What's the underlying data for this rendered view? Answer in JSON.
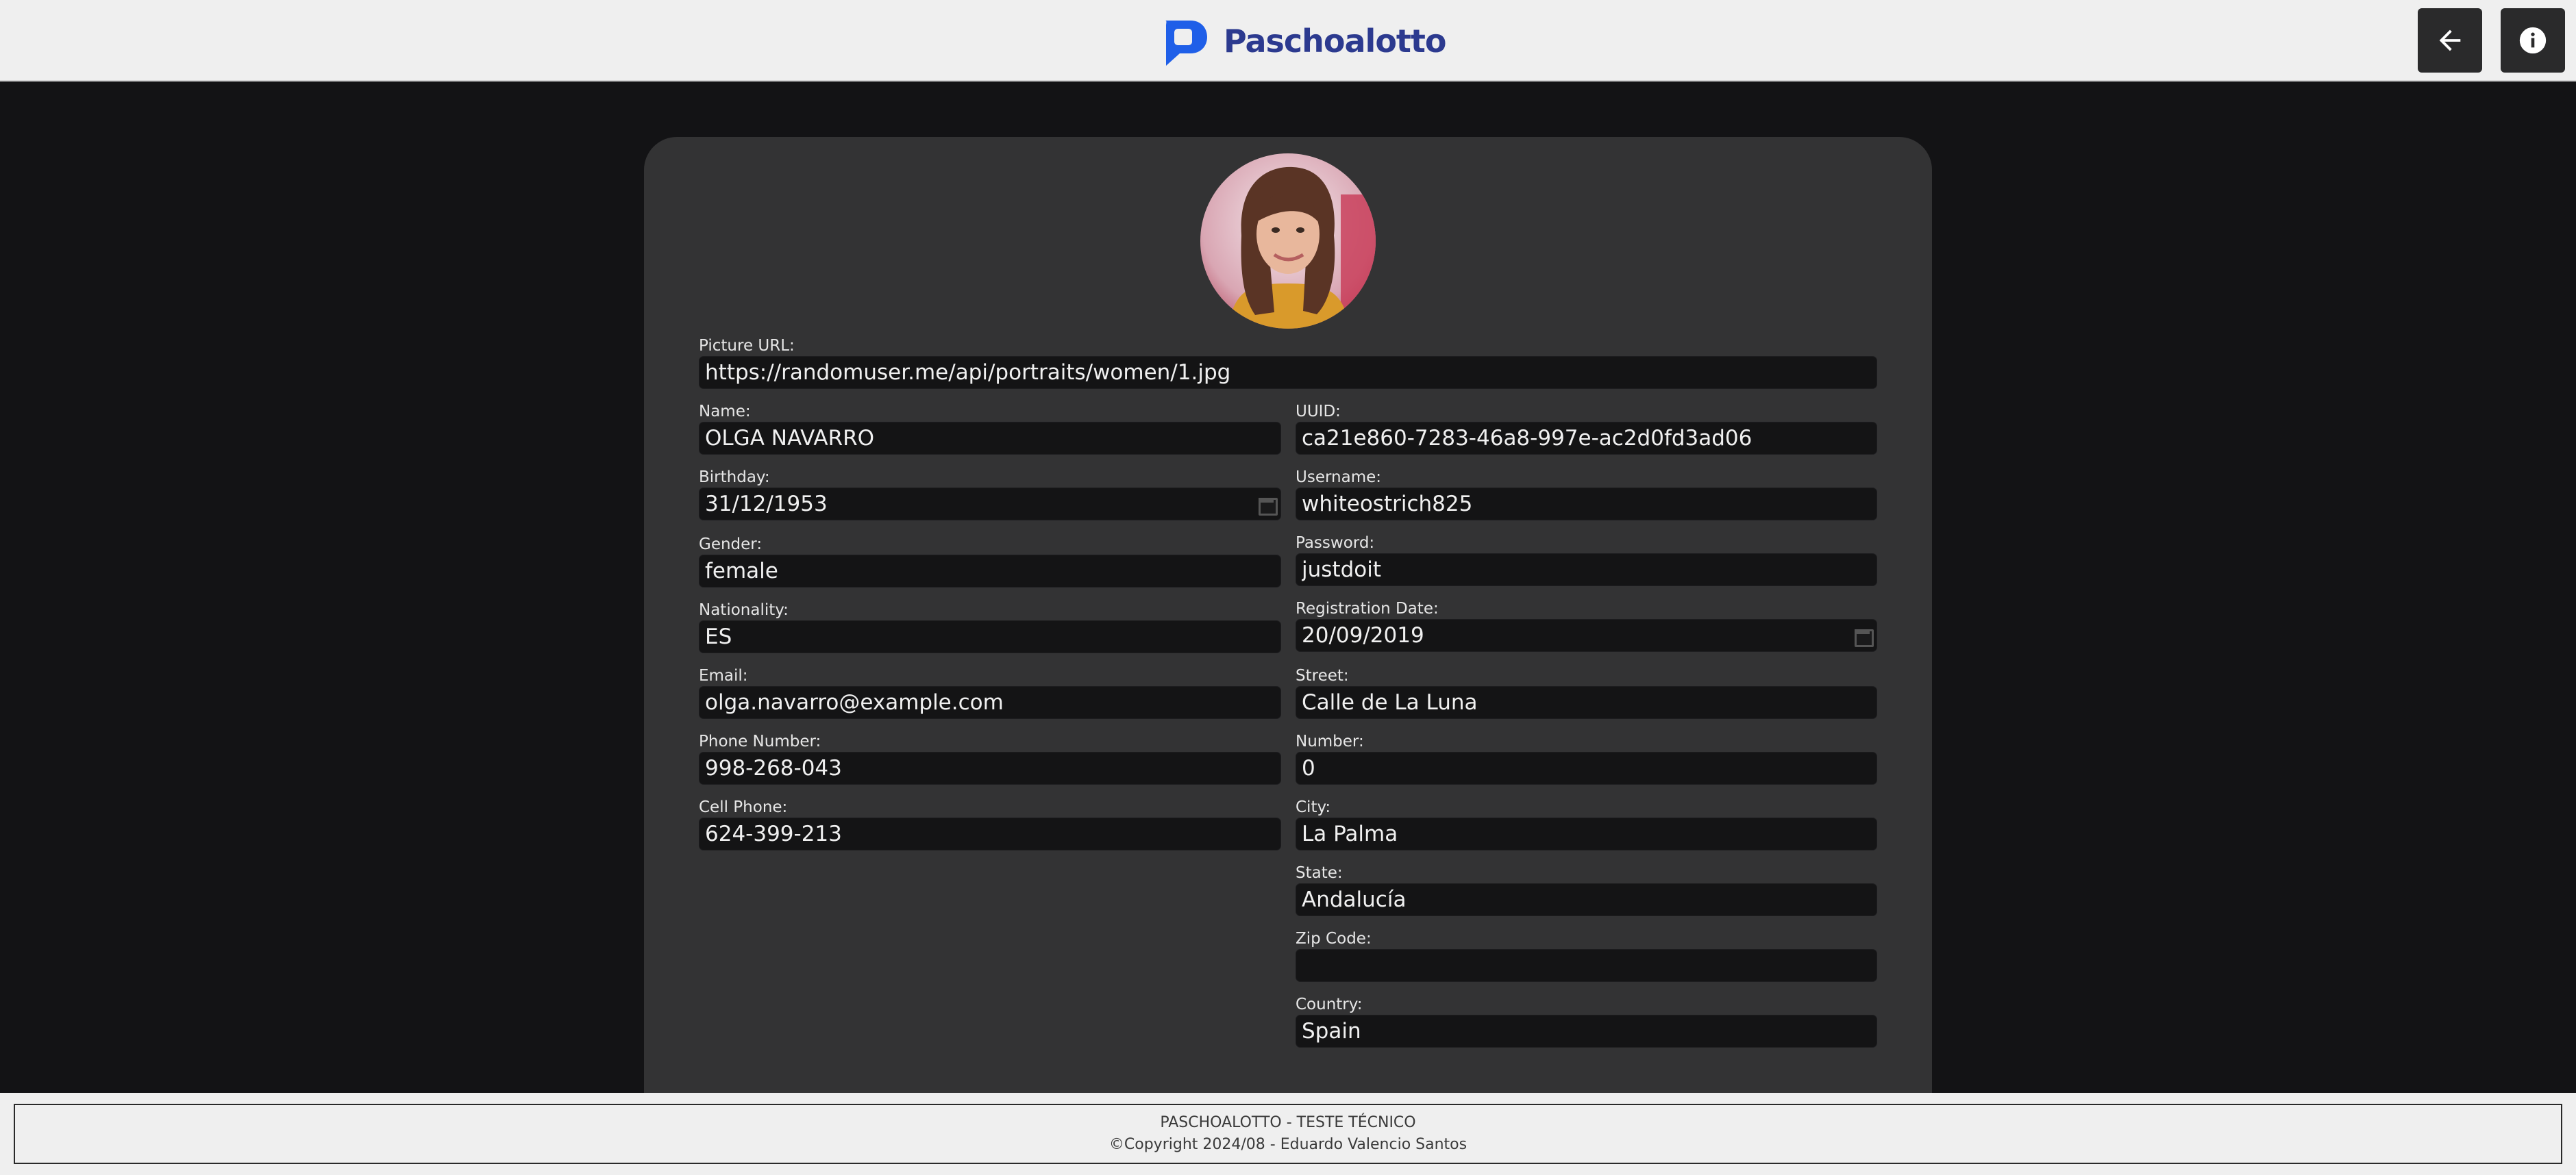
{
  "header": {
    "brand": "Paschoalotto",
    "back_icon": "arrow-left-icon",
    "info_icon": "info-icon",
    "brand_color": "#1f5fe8"
  },
  "profile": {
    "picture_label": "Picture URL:",
    "picture_url": "https://randomuser.me/api/portraits/women/1.jpg",
    "left": [
      {
        "label": "Name:",
        "value": "OLGA NAVARRO"
      },
      {
        "label": "Birthday:",
        "value": "31/12/1953"
      },
      {
        "label": "Gender:",
        "value": "female"
      },
      {
        "label": "Nationality:",
        "value": "ES"
      },
      {
        "label": "Email:",
        "value": "olga.navarro@example.com"
      },
      {
        "label": "Phone Number:",
        "value": "998-268-043"
      },
      {
        "label": "Cell Phone:",
        "value": "624-399-213"
      }
    ],
    "right": [
      {
        "label": "UUID:",
        "value": "ca21e860-7283-46a8-997e-ac2d0fd3ad06"
      },
      {
        "label": "Username:",
        "value": "whiteostrich825"
      },
      {
        "label": "Password:",
        "value": "justdoit"
      },
      {
        "label": "Registration Date:",
        "value": "20/09/2019"
      },
      {
        "label": "Street:",
        "value": "Calle de La Luna"
      },
      {
        "label": "Number:",
        "value": "0"
      },
      {
        "label": "City:",
        "value": "La Palma"
      },
      {
        "label": "State:",
        "value": "Andalucía"
      },
      {
        "label": "Zip Code:",
        "value": ""
      },
      {
        "label": "Country:",
        "value": "Spain"
      }
    ]
  },
  "footer": {
    "line1": "PASCHOALOTTO - TESTE TÉCNICO",
    "line2": "©Copyright 2024/08 - Eduardo Valencio Santos"
  }
}
